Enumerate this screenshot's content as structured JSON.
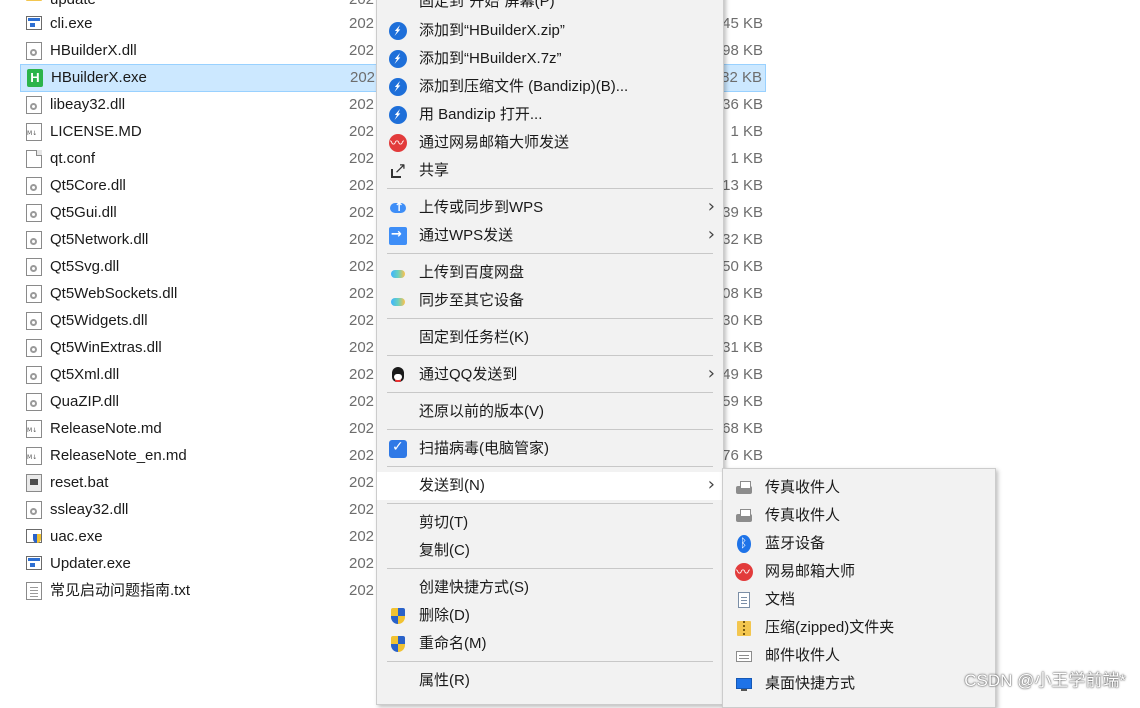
{
  "files": [
    {
      "name": "update",
      "date": "202",
      "size": "",
      "icon": "folder-icon",
      "selected": false
    },
    {
      "name": "cli.exe",
      "date": "202",
      "size": "45 KB",
      "icon": "exe-icon",
      "selected": false
    },
    {
      "name": "HBuilderX.dll",
      "date": "202",
      "size": "98 KB",
      "icon": "dll-icon",
      "selected": false
    },
    {
      "name": "HBuilderX.exe",
      "date": "202",
      "size": "82 KB",
      "icon": "hbuilderx-icon",
      "selected": true
    },
    {
      "name": "libeay32.dll",
      "date": "202",
      "size": "36 KB",
      "icon": "dll-icon",
      "selected": false
    },
    {
      "name": "LICENSE.MD",
      "date": "202",
      "size": "1 KB",
      "icon": "markdown-icon",
      "selected": false
    },
    {
      "name": "qt.conf",
      "date": "202",
      "size": "1 KB",
      "icon": "document-icon",
      "selected": false
    },
    {
      "name": "Qt5Core.dll",
      "date": "202",
      "size": "13 KB",
      "icon": "dll-icon",
      "selected": false
    },
    {
      "name": "Qt5Gui.dll",
      "date": "202",
      "size": "39 KB",
      "icon": "dll-icon",
      "selected": false
    },
    {
      "name": "Qt5Network.dll",
      "date": "202",
      "size": "32 KB",
      "icon": "dll-icon",
      "selected": false
    },
    {
      "name": "Qt5Svg.dll",
      "date": "202",
      "size": "50 KB",
      "icon": "dll-icon",
      "selected": false
    },
    {
      "name": "Qt5WebSockets.dll",
      "date": "202",
      "size": "08 KB",
      "icon": "dll-icon",
      "selected": false
    },
    {
      "name": "Qt5Widgets.dll",
      "date": "202",
      "size": "30 KB",
      "icon": "dll-icon",
      "selected": false
    },
    {
      "name": "Qt5WinExtras.dll",
      "date": "202",
      "size": "31 KB",
      "icon": "dll-icon",
      "selected": false
    },
    {
      "name": "Qt5Xml.dll",
      "date": "202",
      "size": "49 KB",
      "icon": "dll-icon",
      "selected": false
    },
    {
      "name": "QuaZIP.dll",
      "date": "202",
      "size": "59 KB",
      "icon": "dll-icon",
      "selected": false
    },
    {
      "name": "ReleaseNote.md",
      "date": "202",
      "size": "68 KB",
      "icon": "markdown-icon",
      "selected": false
    },
    {
      "name": "ReleaseNote_en.md",
      "date": "202",
      "size": "76 KB",
      "icon": "markdown-icon",
      "selected": false
    },
    {
      "name": "reset.bat",
      "date": "202",
      "size": "",
      "icon": "batch-icon",
      "selected": false
    },
    {
      "name": "ssleay32.dll",
      "date": "202",
      "size": "",
      "icon": "dll-icon",
      "selected": false
    },
    {
      "name": "uac.exe",
      "date": "202",
      "size": "",
      "icon": "uac-exe-icon",
      "selected": false
    },
    {
      "name": "Updater.exe",
      "date": "202",
      "size": "",
      "icon": "exe-icon",
      "selected": false
    },
    {
      "name": "常见启动问题指南.txt",
      "date": "202",
      "size": "",
      "icon": "text-file-icon",
      "selected": false
    }
  ],
  "context_menu": {
    "items": [
      {
        "label": "固定到\"开始\"屏幕(P)",
        "icon": "",
        "submenu": false
      },
      {
        "label": "添加到“HBuilderX.zip”",
        "icon": "bandizip-icon",
        "submenu": false
      },
      {
        "label": "添加到“HBuilderX.7z”",
        "icon": "bandizip-icon",
        "submenu": false
      },
      {
        "label": "添加到压缩文件 (Bandizip)(B)...",
        "icon": "bandizip-icon",
        "submenu": false
      },
      {
        "label": "用 Bandizip 打开...",
        "icon": "bandizip-icon",
        "submenu": false
      },
      {
        "label": "通过网易邮箱大师发送",
        "icon": "mail-master-icon",
        "submenu": false
      },
      {
        "label": "共享",
        "icon": "share-icon",
        "submenu": false
      },
      {
        "label": "上传或同步到WPS",
        "icon": "wps-cloud-upload-icon",
        "submenu": true
      },
      {
        "label": "通过WPS发送",
        "icon": "wps-send-icon",
        "submenu": true
      },
      {
        "label": "上传到百度网盘",
        "icon": "baidu-netdisk-icon",
        "submenu": false
      },
      {
        "label": "同步至其它设备",
        "icon": "baidu-netdisk-icon",
        "submenu": false
      },
      {
        "label": "固定到任务栏(K)",
        "icon": "",
        "submenu": false
      },
      {
        "label": "通过QQ发送到",
        "icon": "qq-icon",
        "submenu": true
      },
      {
        "label": "还原以前的版本(V)",
        "icon": "",
        "submenu": false
      },
      {
        "label": "扫描病毒(电脑管家)",
        "icon": "pc-manager-shield-icon",
        "submenu": false
      },
      {
        "label": "发送到(N)",
        "icon": "",
        "submenu": true
      },
      {
        "label": "剪切(T)",
        "icon": "",
        "submenu": false
      },
      {
        "label": "复制(C)",
        "icon": "",
        "submenu": false
      },
      {
        "label": "创建快捷方式(S)",
        "icon": "",
        "submenu": false
      },
      {
        "label": "删除(D)",
        "icon": "uac-shield-icon",
        "submenu": false
      },
      {
        "label": "重命名(M)",
        "icon": "uac-shield-icon",
        "submenu": false
      },
      {
        "label": "属性(R)",
        "icon": "",
        "submenu": false
      }
    ],
    "submenu_arrow": "›"
  },
  "sendto_menu": {
    "items": [
      {
        "label": "传真收件人",
        "icon": "fax-icon"
      },
      {
        "label": "传真收件人",
        "icon": "fax-icon"
      },
      {
        "label": "蓝牙设备",
        "icon": "bluetooth-icon"
      },
      {
        "label": "网易邮箱大师",
        "icon": "mail-master-icon"
      },
      {
        "label": "文档",
        "icon": "documents-icon"
      },
      {
        "label": "压缩(zipped)文件夹",
        "icon": "zip-folder-icon"
      },
      {
        "label": "邮件收件人",
        "icon": "mail-recipient-icon"
      },
      {
        "label": "桌面快捷方式",
        "icon": "desktop-shortcut-icon"
      }
    ]
  },
  "watermark": "CSDN @小王学前端*",
  "colors": {
    "selection": "#cce8ff",
    "menu_background": "#f2f2f2",
    "menu_hover": "#ffffff",
    "accent": "#1e73e8"
  }
}
